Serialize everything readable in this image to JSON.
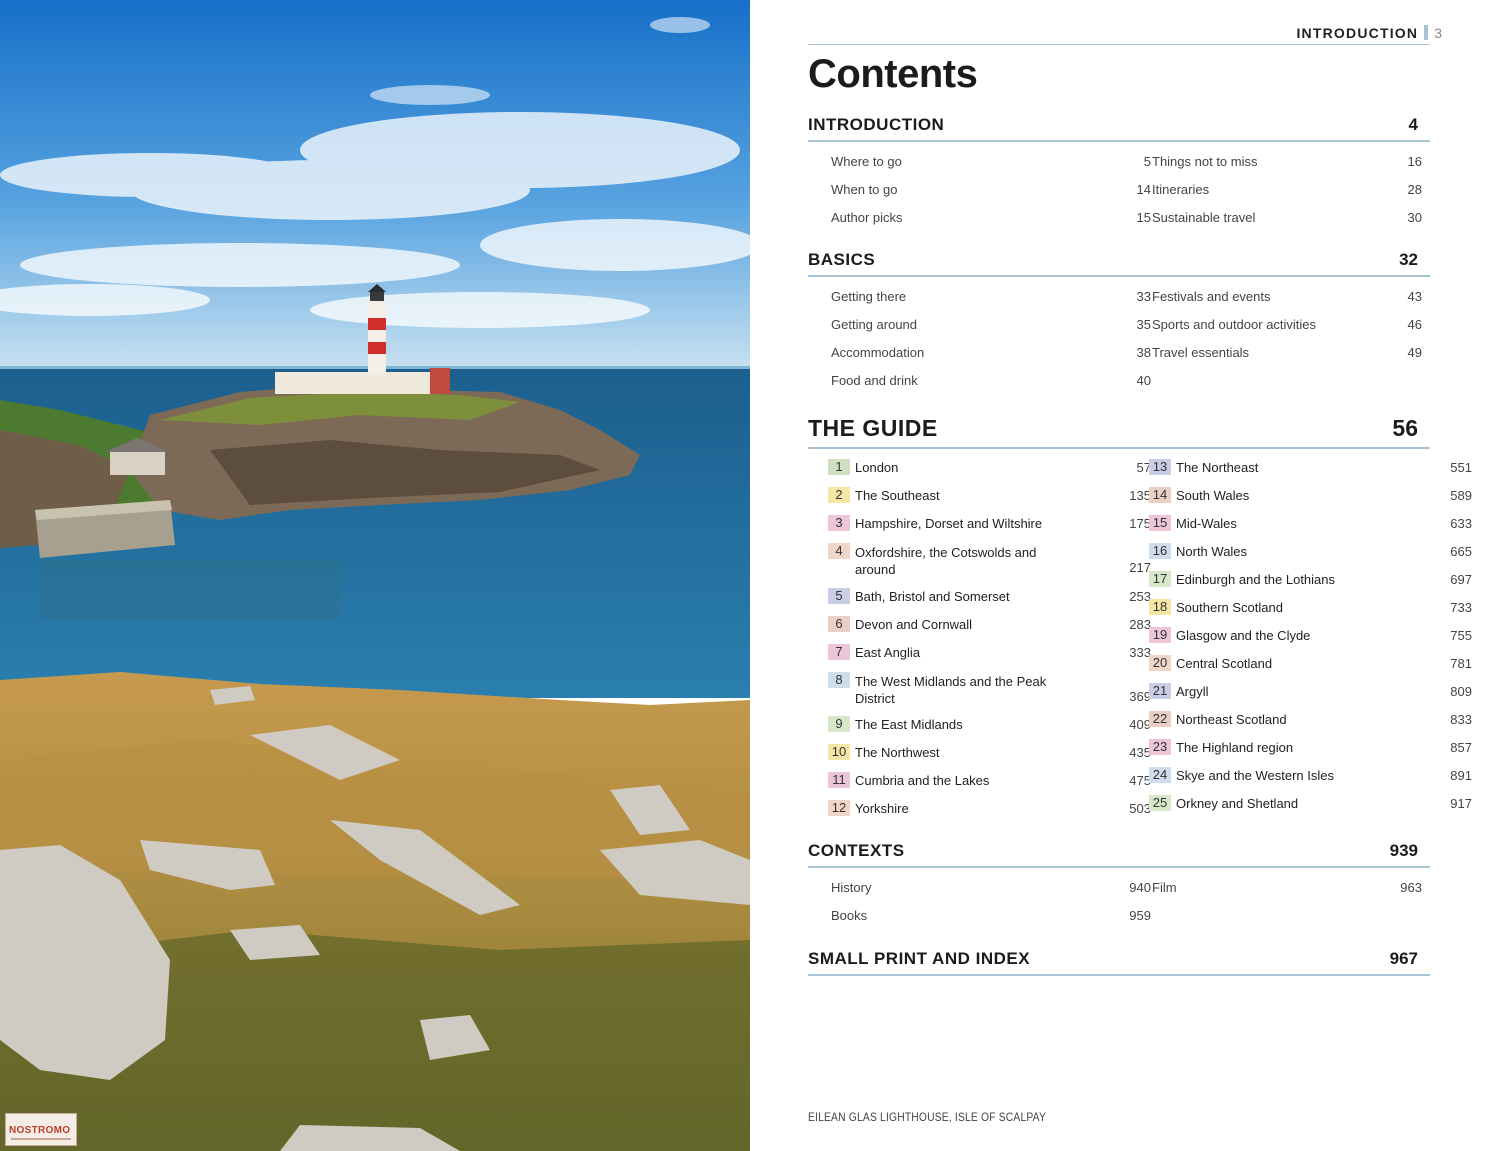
{
  "stamp": {
    "text": "NOSTROMO"
  },
  "header": {
    "section": "INTRODUCTION",
    "page": "3"
  },
  "title": "Contents",
  "introduction": {
    "label": "INTRODUCTION",
    "page": "4",
    "items": [
      {
        "name": "Where to go",
        "page": "5"
      },
      {
        "name": "When to go",
        "page": "14"
      },
      {
        "name": "Author picks",
        "page": "15"
      },
      {
        "name": "Things not to miss",
        "page": "16"
      },
      {
        "name": "Itineraries",
        "page": "28"
      },
      {
        "name": "Sustainable travel",
        "page": "30"
      }
    ]
  },
  "basics": {
    "label": "BASICS",
    "page": "32",
    "items": [
      {
        "name": "Getting there",
        "page": "33"
      },
      {
        "name": "Getting around",
        "page": "35"
      },
      {
        "name": "Accommodation",
        "page": "38"
      },
      {
        "name": "Food and drink",
        "page": "40"
      },
      {
        "name": "Festivals and events",
        "page": "43"
      },
      {
        "name": "Sports and outdoor activities",
        "page": "46"
      },
      {
        "name": "Travel essentials",
        "page": "49"
      }
    ]
  },
  "guide": {
    "label": "THE GUIDE",
    "page": "56",
    "chapters": [
      {
        "num": "1",
        "name": "London",
        "page": "57",
        "color": "#cfe0c3"
      },
      {
        "num": "2",
        "name": "The Southeast",
        "page": "135",
        "color": "#f4e7a6"
      },
      {
        "num": "3",
        "name": "Hampshire, Dorset and Wiltshire",
        "page": "175",
        "color": "#ecc6d8"
      },
      {
        "num": "4",
        "name": "Oxfordshire, the Cotswolds and around",
        "page": "217",
        "color": "#efd6c8"
      },
      {
        "num": "5",
        "name": "Bath, Bristol and Somerset",
        "page": "253",
        "color": "#c9cde6"
      },
      {
        "num": "6",
        "name": "Devon and Cornwall",
        "page": "283",
        "color": "#eacfc6"
      },
      {
        "num": "7",
        "name": "East Anglia",
        "page": "333",
        "color": "#ecc6d8"
      },
      {
        "num": "8",
        "name": "The West Midlands and the Peak District",
        "page": "369",
        "color": "#cfdcea"
      },
      {
        "num": "9",
        "name": "The East Midlands",
        "page": "409",
        "color": "#d6e8c9"
      },
      {
        "num": "10",
        "name": "The Northwest",
        "page": "435",
        "color": "#f4e7a6"
      },
      {
        "num": "11",
        "name": "Cumbria and the Lakes",
        "page": "475",
        "color": "#ecc6d8"
      },
      {
        "num": "12",
        "name": "Yorkshire",
        "page": "503",
        "color": "#efd6c8"
      },
      {
        "num": "13",
        "name": "The Northeast",
        "page": "551",
        "color": "#c9cde6"
      },
      {
        "num": "14",
        "name": "South Wales",
        "page": "589",
        "color": "#eacfc6"
      },
      {
        "num": "15",
        "name": "Mid-Wales",
        "page": "633",
        "color": "#ecc6d8"
      },
      {
        "num": "16",
        "name": "North Wales",
        "page": "665",
        "color": "#cfdcea"
      },
      {
        "num": "17",
        "name": "Edinburgh and the Lothians",
        "page": "697",
        "color": "#d6e8c9"
      },
      {
        "num": "18",
        "name": "Southern Scotland",
        "page": "733",
        "color": "#f4e7a6"
      },
      {
        "num": "19",
        "name": "Glasgow and the Clyde",
        "page": "755",
        "color": "#ecc6d8"
      },
      {
        "num": "20",
        "name": "Central Scotland",
        "page": "781",
        "color": "#efd6c8"
      },
      {
        "num": "21",
        "name": "Argyll",
        "page": "809",
        "color": "#c9cde6"
      },
      {
        "num": "22",
        "name": "Northeast Scotland",
        "page": "833",
        "color": "#eacfc6"
      },
      {
        "num": "23",
        "name": "The Highland region",
        "page": "857",
        "color": "#ecc6d8"
      },
      {
        "num": "24",
        "name": "Skye and the Western Isles",
        "page": "891",
        "color": "#cfdcea"
      },
      {
        "num": "25",
        "name": "Orkney and Shetland",
        "page": "917",
        "color": "#d6e8c9"
      }
    ]
  },
  "contexts": {
    "label": "CONTEXTS",
    "page": "939",
    "items": [
      {
        "name": "History",
        "page": "940"
      },
      {
        "name": "Books",
        "page": "959"
      },
      {
        "name": "Film",
        "page": "963"
      }
    ]
  },
  "smallprint": {
    "label": "SMALL PRINT AND INDEX",
    "page": "967"
  },
  "caption": "EILEAN GLAS LIGHTHOUSE, ISLE OF SCALPAY",
  "colors": {
    "rule": "#a8c3d3"
  }
}
